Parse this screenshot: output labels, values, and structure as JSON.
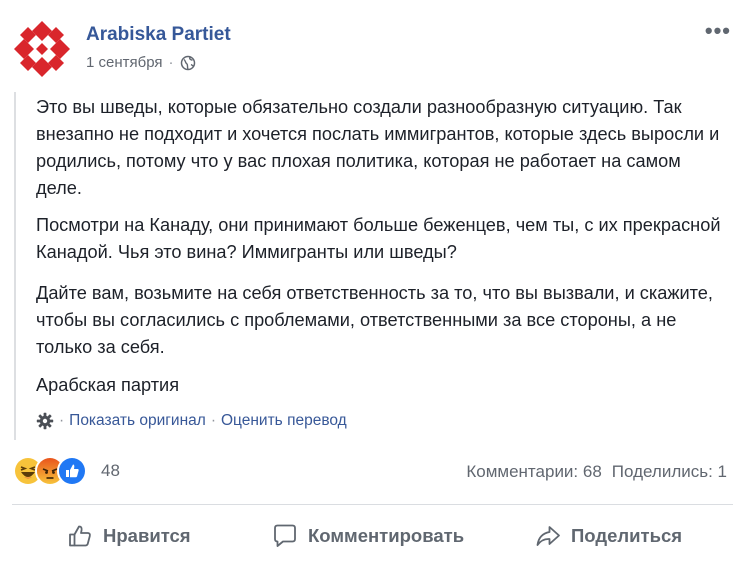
{
  "post": {
    "page_name": "Arabiska Partiet",
    "date": "1 сентября",
    "separator": "·",
    "more_label": "•••",
    "paragraphs": [
      "Это вы шведы, которые обязательно создали разнообразную ситуацию. Так внезапно не подходит и хочется послать иммигрантов, которые здесь выросли и родились, потому что у вас плохая политика, которая не работает на самом деле.",
      "Посмотри на Канаду, они принимают больше беженцев, чем ты, с их прекрасной Канадой. Чья это вина? Иммигранты или шведы?",
      "Дайте вам, возьмите на себя ответственность за то, что вы вызвали, и скажите, чтобы вы согласились с проблемами, ответственными за все стороны, а не только за себя.",
      "Арабская партия"
    ],
    "show_original": "Показать оригинал",
    "rate_translation": "Оценить перевод",
    "link_separator": "·"
  },
  "stats": {
    "reaction_count": "48",
    "reactions": [
      "haha",
      "angry",
      "like"
    ],
    "comments": "Комментарии: 68",
    "shares": "Поделились: 1"
  },
  "actions": {
    "like": "Нравится",
    "comment": "Комментировать",
    "share": "Поделиться"
  },
  "colors": {
    "link": "#365899",
    "muted": "#616770",
    "avatar_red": "#d9262c"
  }
}
